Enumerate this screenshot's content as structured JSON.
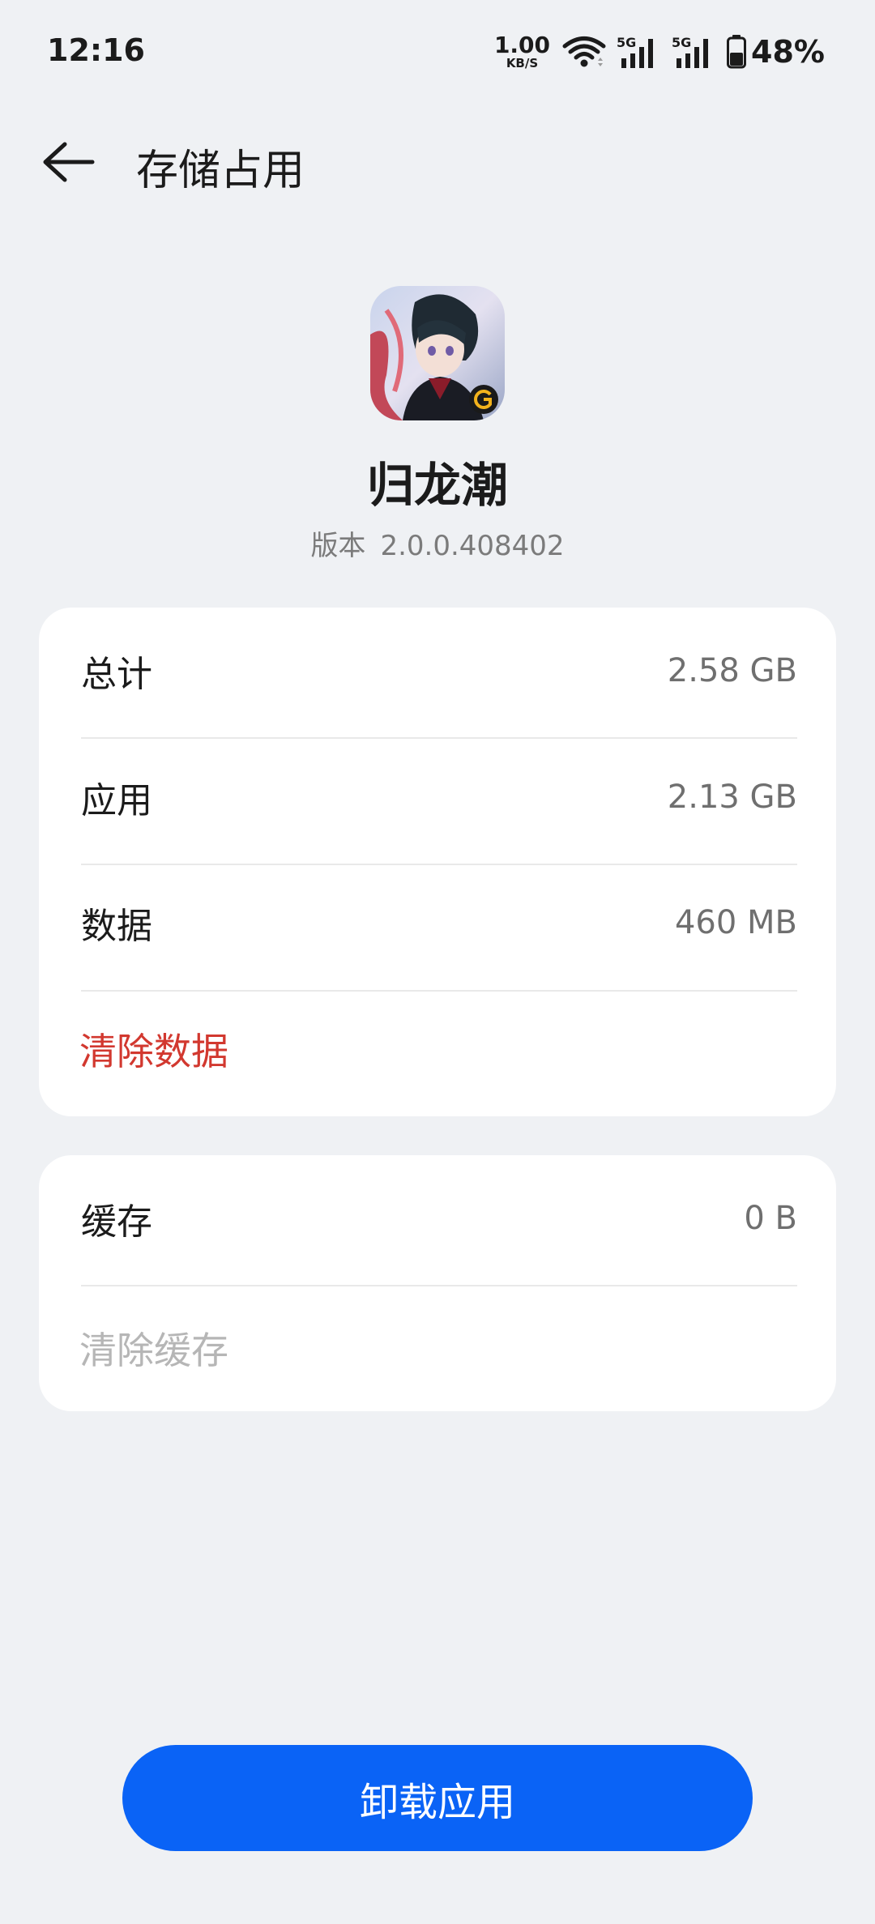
{
  "status_bar": {
    "time": "12:16",
    "net_speed_value": "1.00",
    "net_speed_unit": "KB/S",
    "signal_label_1": "5G",
    "signal_label_2": "5G",
    "battery_percent": "48%"
  },
  "header": {
    "title": "存储占用"
  },
  "app": {
    "name": "归龙潮",
    "version_label": "版本",
    "version_value": "2.0.0.408402"
  },
  "storage": {
    "rows": [
      {
        "label": "总计",
        "value": "2.58 GB"
      },
      {
        "label": "应用",
        "value": "2.13 GB"
      },
      {
        "label": "数据",
        "value": "460 MB"
      }
    ],
    "clear_data_label": "清除数据"
  },
  "cache": {
    "label": "缓存",
    "value": "0 B",
    "clear_cache_label": "清除缓存"
  },
  "uninstall_label": "卸载应用",
  "colors": {
    "accent": "#0a63f6",
    "danger": "#d2382f",
    "background": "#eff1f4"
  }
}
